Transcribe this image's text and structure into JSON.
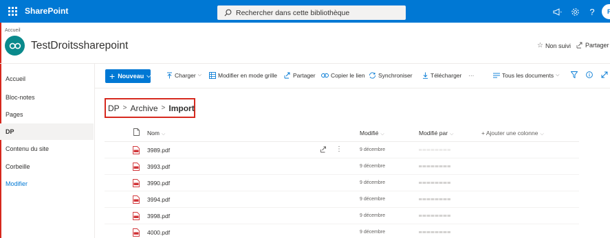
{
  "suite": {
    "app_name": "SharePoint",
    "search_placeholder": "Rechercher dans cette bibliothèque",
    "avatar_initials": "P",
    "accent_color": "#0078d4"
  },
  "site": {
    "top_breadcrumb": "Accueil",
    "title": "TestDroitssharepoint",
    "follow_label": "Non suivi",
    "share_label": "Partager"
  },
  "nav": {
    "items": [
      {
        "label": "Accueil",
        "selected": false
      },
      {
        "label": "Bloc-notes",
        "selected": false
      },
      {
        "label": "Pages",
        "selected": false
      },
      {
        "label": "DP",
        "selected": true
      },
      {
        "label": "Contenu du site",
        "selected": false
      },
      {
        "label": "Corbeille",
        "selected": false
      },
      {
        "label": "Modifier",
        "selected": false,
        "link": true
      }
    ]
  },
  "commands": {
    "new_label": "Nouveau",
    "upload_label": "Charger",
    "grid_label": "Modifier en mode grille",
    "share_label": "Partager",
    "copy_link_label": "Copier le lien",
    "sync_label": "Synchroniser",
    "download_label": "Télécharger",
    "more_label": "···",
    "view_label": "Tous les documents"
  },
  "breadcrumb": {
    "items": [
      "DP",
      "Archive",
      "Import"
    ]
  },
  "table": {
    "columns": {
      "name": "Nom",
      "modified": "Modifié",
      "modified_by": "Modifié par",
      "add_column": "+ Ajouter une colonne"
    },
    "rows": [
      {
        "name": "3989.pdf",
        "modified": "9 décembre"
      },
      {
        "name": "3993.pdf",
        "modified": "9 décembre"
      },
      {
        "name": "3990.pdf",
        "modified": "9 décembre"
      },
      {
        "name": "3994.pdf",
        "modified": "9 décembre"
      },
      {
        "name": "3998.pdf",
        "modified": "9 décembre"
      },
      {
        "name": "4000.pdf",
        "modified": "9 décembre"
      }
    ]
  },
  "colors": {
    "highlight_border": "#d6281d",
    "site_logo": "#0a8a8c",
    "pdf_red": "#d13438"
  },
  "icons": [
    "waffle-icon",
    "search-icon",
    "megaphone-icon",
    "gear-icon",
    "help-icon",
    "star-icon",
    "share-icon",
    "upload-icon",
    "grid-icon",
    "link-icon",
    "sync-icon",
    "download-icon",
    "filter-icon",
    "info-icon",
    "expand-icon",
    "file-header-icon",
    "pdf-icon",
    "more-icon",
    "chevron-down-icon"
  ]
}
